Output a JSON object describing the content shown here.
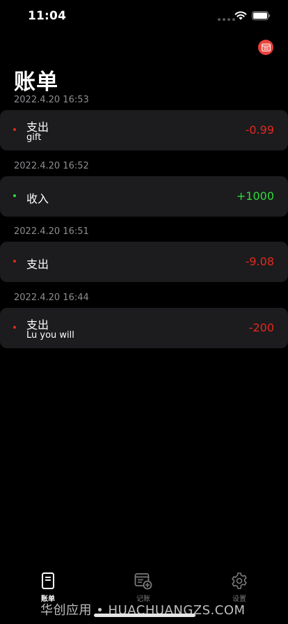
{
  "status_bar": {
    "time": "11:04"
  },
  "header": {
    "title": "账单"
  },
  "transactions": [
    {
      "date": "2022.4.20 16:53",
      "type": "支出",
      "note": "gift",
      "amount": "-0.99",
      "kind": "expense"
    },
    {
      "date": "2022.4.20 16:52",
      "type": "收入",
      "note": "",
      "amount": "+1000",
      "kind": "income"
    },
    {
      "date": "2022.4.20 16:51",
      "type": "支出",
      "note": "",
      "amount": "-9.08",
      "kind": "expense"
    },
    {
      "date": "2022.4.20 16:44",
      "type": "支出",
      "note": "Lu you will",
      "amount": "-200",
      "kind": "expense"
    }
  ],
  "tab_bar": {
    "items": [
      {
        "label": "账单",
        "icon": "document-icon",
        "active": true
      },
      {
        "label": "记账",
        "icon": "add-record-icon",
        "active": false
      },
      {
        "label": "设置",
        "icon": "gear-icon",
        "active": false
      }
    ]
  },
  "watermark": "华创应用 • HUACHUANGZS.COM",
  "colors": {
    "expense": "#e5281e",
    "income": "#2ddc3a",
    "card": "#1c1c1e",
    "accent": "#e8433b"
  }
}
